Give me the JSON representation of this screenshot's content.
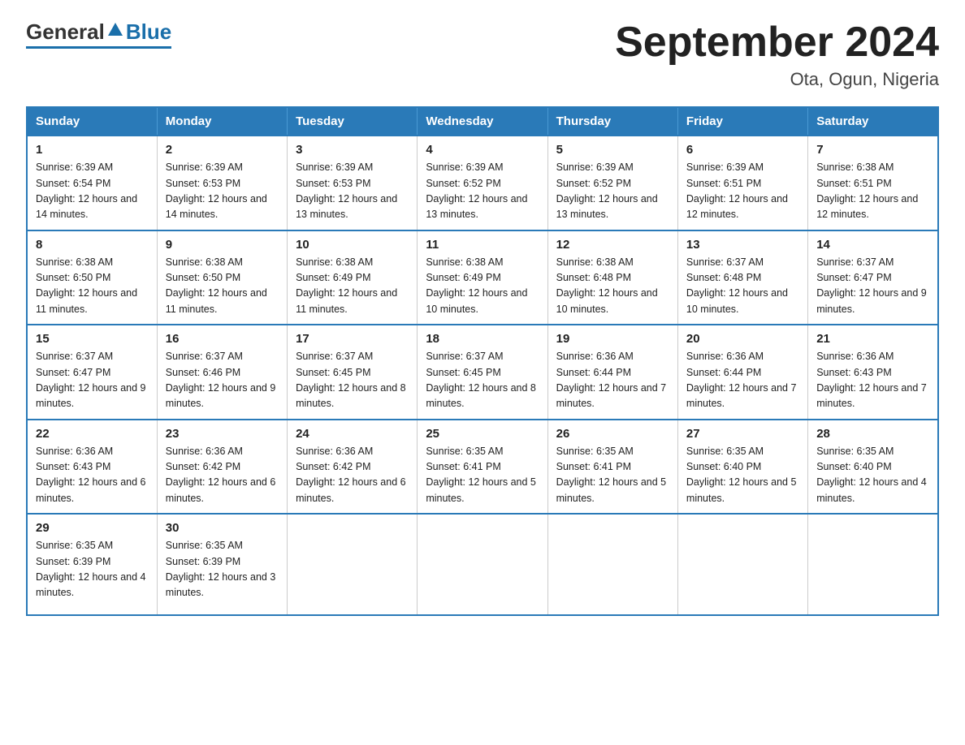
{
  "header": {
    "logo_general": "General",
    "logo_blue": "Blue",
    "main_title": "September 2024",
    "subtitle": "Ota, Ogun, Nigeria"
  },
  "columns": [
    "Sunday",
    "Monday",
    "Tuesday",
    "Wednesday",
    "Thursday",
    "Friday",
    "Saturday"
  ],
  "weeks": [
    [
      {
        "day": "1",
        "sunrise": "6:39 AM",
        "sunset": "6:54 PM",
        "daylight": "12 hours and 14 minutes."
      },
      {
        "day": "2",
        "sunrise": "6:39 AM",
        "sunset": "6:53 PM",
        "daylight": "12 hours and 14 minutes."
      },
      {
        "day": "3",
        "sunrise": "6:39 AM",
        "sunset": "6:53 PM",
        "daylight": "12 hours and 13 minutes."
      },
      {
        "day": "4",
        "sunrise": "6:39 AM",
        "sunset": "6:52 PM",
        "daylight": "12 hours and 13 minutes."
      },
      {
        "day": "5",
        "sunrise": "6:39 AM",
        "sunset": "6:52 PM",
        "daylight": "12 hours and 13 minutes."
      },
      {
        "day": "6",
        "sunrise": "6:39 AM",
        "sunset": "6:51 PM",
        "daylight": "12 hours and 12 minutes."
      },
      {
        "day": "7",
        "sunrise": "6:38 AM",
        "sunset": "6:51 PM",
        "daylight": "12 hours and 12 minutes."
      }
    ],
    [
      {
        "day": "8",
        "sunrise": "6:38 AM",
        "sunset": "6:50 PM",
        "daylight": "12 hours and 11 minutes."
      },
      {
        "day": "9",
        "sunrise": "6:38 AM",
        "sunset": "6:50 PM",
        "daylight": "12 hours and 11 minutes."
      },
      {
        "day": "10",
        "sunrise": "6:38 AM",
        "sunset": "6:49 PM",
        "daylight": "12 hours and 11 minutes."
      },
      {
        "day": "11",
        "sunrise": "6:38 AM",
        "sunset": "6:49 PM",
        "daylight": "12 hours and 10 minutes."
      },
      {
        "day": "12",
        "sunrise": "6:38 AM",
        "sunset": "6:48 PM",
        "daylight": "12 hours and 10 minutes."
      },
      {
        "day": "13",
        "sunrise": "6:37 AM",
        "sunset": "6:48 PM",
        "daylight": "12 hours and 10 minutes."
      },
      {
        "day": "14",
        "sunrise": "6:37 AM",
        "sunset": "6:47 PM",
        "daylight": "12 hours and 9 minutes."
      }
    ],
    [
      {
        "day": "15",
        "sunrise": "6:37 AM",
        "sunset": "6:47 PM",
        "daylight": "12 hours and 9 minutes."
      },
      {
        "day": "16",
        "sunrise": "6:37 AM",
        "sunset": "6:46 PM",
        "daylight": "12 hours and 9 minutes."
      },
      {
        "day": "17",
        "sunrise": "6:37 AM",
        "sunset": "6:45 PM",
        "daylight": "12 hours and 8 minutes."
      },
      {
        "day": "18",
        "sunrise": "6:37 AM",
        "sunset": "6:45 PM",
        "daylight": "12 hours and 8 minutes."
      },
      {
        "day": "19",
        "sunrise": "6:36 AM",
        "sunset": "6:44 PM",
        "daylight": "12 hours and 7 minutes."
      },
      {
        "day": "20",
        "sunrise": "6:36 AM",
        "sunset": "6:44 PM",
        "daylight": "12 hours and 7 minutes."
      },
      {
        "day": "21",
        "sunrise": "6:36 AM",
        "sunset": "6:43 PM",
        "daylight": "12 hours and 7 minutes."
      }
    ],
    [
      {
        "day": "22",
        "sunrise": "6:36 AM",
        "sunset": "6:43 PM",
        "daylight": "12 hours and 6 minutes."
      },
      {
        "day": "23",
        "sunrise": "6:36 AM",
        "sunset": "6:42 PM",
        "daylight": "12 hours and 6 minutes."
      },
      {
        "day": "24",
        "sunrise": "6:36 AM",
        "sunset": "6:42 PM",
        "daylight": "12 hours and 6 minutes."
      },
      {
        "day": "25",
        "sunrise": "6:35 AM",
        "sunset": "6:41 PM",
        "daylight": "12 hours and 5 minutes."
      },
      {
        "day": "26",
        "sunrise": "6:35 AM",
        "sunset": "6:41 PM",
        "daylight": "12 hours and 5 minutes."
      },
      {
        "day": "27",
        "sunrise": "6:35 AM",
        "sunset": "6:40 PM",
        "daylight": "12 hours and 5 minutes."
      },
      {
        "day": "28",
        "sunrise": "6:35 AM",
        "sunset": "6:40 PM",
        "daylight": "12 hours and 4 minutes."
      }
    ],
    [
      {
        "day": "29",
        "sunrise": "6:35 AM",
        "sunset": "6:39 PM",
        "daylight": "12 hours and 4 minutes."
      },
      {
        "day": "30",
        "sunrise": "6:35 AM",
        "sunset": "6:39 PM",
        "daylight": "12 hours and 3 minutes."
      },
      null,
      null,
      null,
      null,
      null
    ]
  ]
}
